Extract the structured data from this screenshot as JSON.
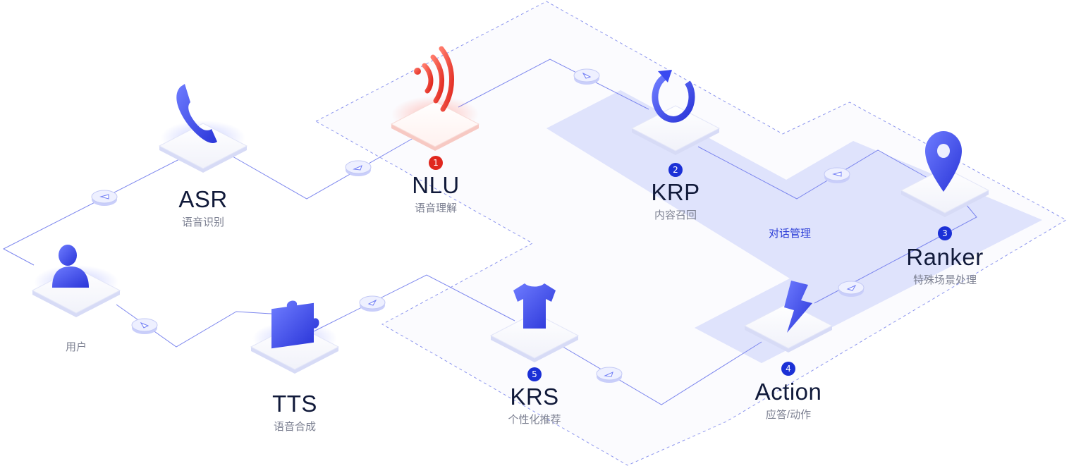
{
  "nodes": {
    "asr": {
      "name": "ASR",
      "sub": "语音识别"
    },
    "nlu": {
      "name": "NLU",
      "sub": "语音理解",
      "badge": "1"
    },
    "krp": {
      "name": "KRP",
      "sub": "内容召回",
      "badge": "2"
    },
    "ranker": {
      "name": "Ranker",
      "sub": "特殊场景处理",
      "badge": "3"
    },
    "action": {
      "name": "Action",
      "sub": "应答/动作",
      "badge": "4"
    },
    "krs": {
      "name": "KRS",
      "sub": "个性化推荐",
      "badge": "5"
    },
    "tts": {
      "name": "TTS",
      "sub": "语音合成"
    },
    "user": {
      "sub": "用户"
    }
  },
  "region_label": "对话管理",
  "icons": {
    "asr": "phone-icon",
    "nlu": "signal-icon",
    "krp": "refresh-icon",
    "ranker": "location-pin-icon",
    "action": "lightning-icon",
    "krs": "tshirt-icon",
    "tts": "puzzle-icon",
    "user": "user-icon"
  },
  "colors": {
    "accent": "#3a49f0",
    "highlight": "#e0271e",
    "badge_blue": "#1b30d6",
    "line": "#7c86ee",
    "region_fill": "#dfe2fc"
  }
}
